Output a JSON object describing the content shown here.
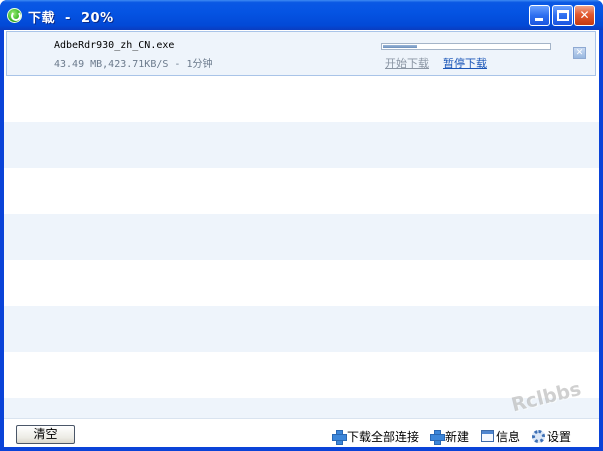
{
  "window": {
    "title": "下载  -  20%",
    "buttons": {
      "minimize": "minimize",
      "maximize": "maximize",
      "close": "✕"
    }
  },
  "download": {
    "filename": "AdbeRdr930_zh_CN.exe",
    "info": "43.49 MB,423.71KB/S - 1分钟",
    "progress_fraction": 0.2,
    "start_label": "开始下载",
    "pause_label": "暂停下载",
    "remove_label": "✕"
  },
  "footer": {
    "clear_label": "清空",
    "download_all_label": "下载全部连接",
    "new_label": "新建",
    "info_label": "信息",
    "settings_label": "设置"
  },
  "watermark": "Rclbbs",
  "colors": {
    "titlebar": "#0554e3",
    "stripe": "#eef4fb",
    "item_border": "#a9c4e8",
    "link_active": "#1b56b8",
    "link_inactive": "#8a95a3"
  },
  "icons": [
    "app-icon",
    "minimize-icon",
    "maximize-icon",
    "close-icon",
    "remove-item-icon",
    "plus-icon",
    "info-icon",
    "gear-icon"
  ]
}
